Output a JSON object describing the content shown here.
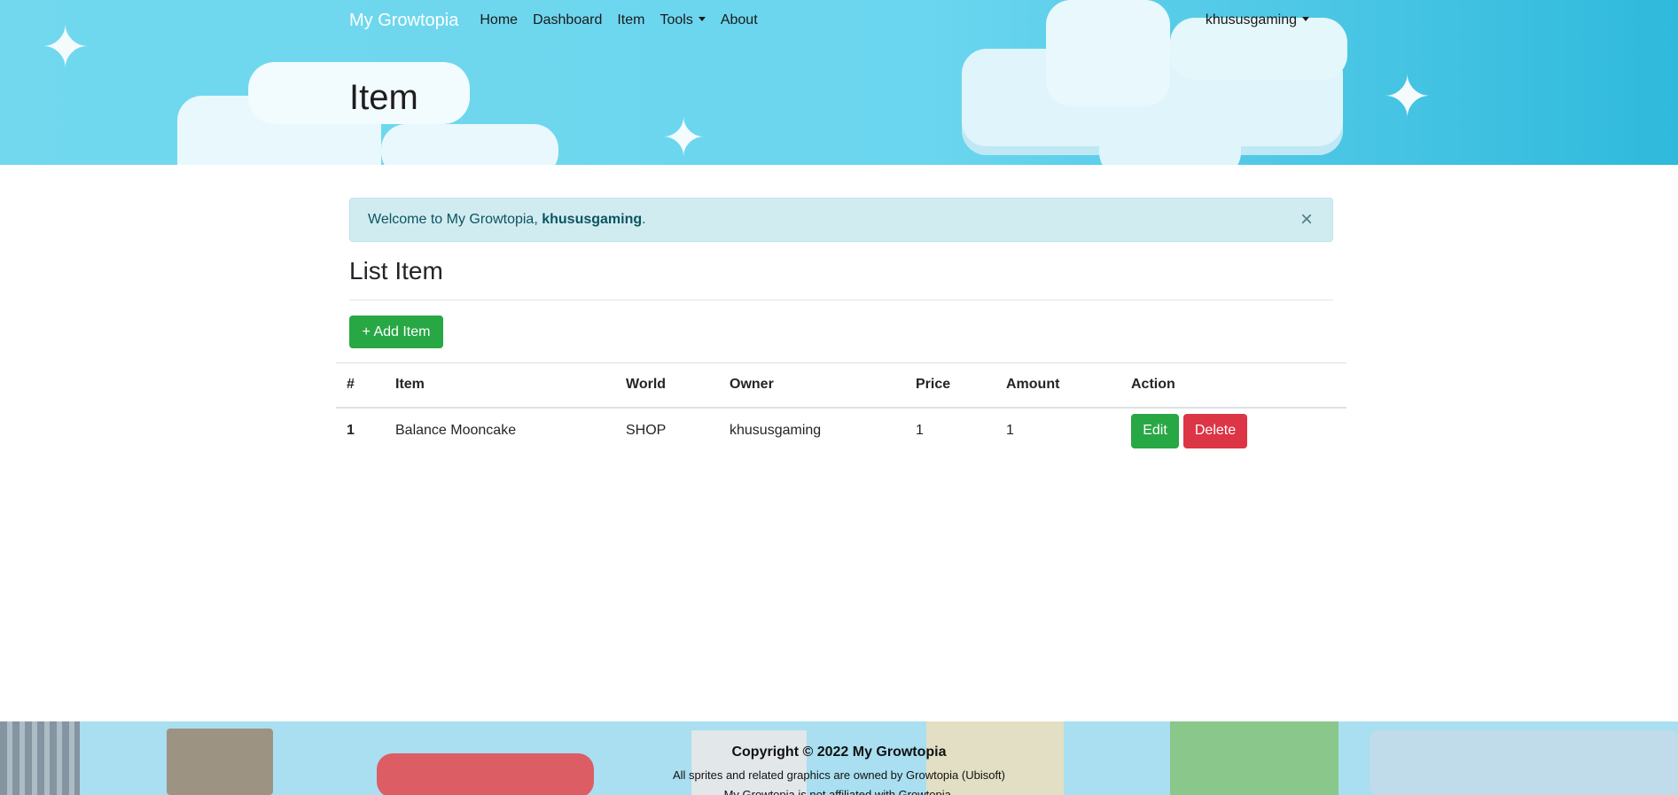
{
  "nav": {
    "brand": "My Growtopia",
    "links": [
      "Home",
      "Dashboard",
      "Item",
      "Tools",
      "About"
    ],
    "user": "khususgaming"
  },
  "header": {
    "title": "Item"
  },
  "alert": {
    "prefix": "Welcome to My Growtopia, ",
    "username": "khususgaming",
    "suffix": ".",
    "close": "×"
  },
  "section": {
    "title": "List Item",
    "add_button": "+ Add Item"
  },
  "table": {
    "headers": [
      "#",
      "Item",
      "World",
      "Owner",
      "Price",
      "Amount",
      "Action"
    ],
    "rows": [
      {
        "no": "1",
        "item": "Balance Mooncake",
        "world": "SHOP",
        "owner": "khususgaming",
        "price": "1",
        "amount": "1",
        "edit": "Edit",
        "delete": "Delete"
      }
    ]
  },
  "footer": {
    "copyright": "Copyright © 2022 My Growtopia",
    "line2": "All sprites and related graphics are owned by Growtopia (Ubisoft)",
    "line3": "My Growtopia is not affiliated with Growtopia."
  },
  "colors": {
    "success": "#28a745",
    "danger": "#dc3545",
    "alert_bg": "#d1ecf1",
    "alert_text": "#0c5460"
  }
}
